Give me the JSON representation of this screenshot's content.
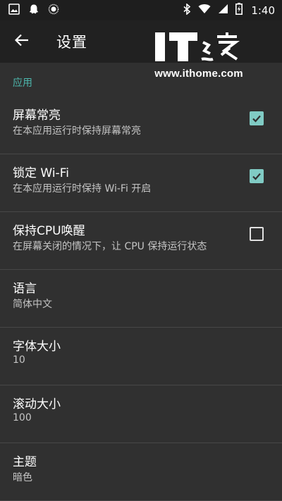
{
  "status_bar": {
    "time": "1:40",
    "icons": [
      "image-icon",
      "ghost-icon",
      "circle-icon",
      "bluetooth-icon",
      "wifi-icon",
      "signal-icon",
      "battery-charging-icon"
    ]
  },
  "app_bar": {
    "title": "设置",
    "back_icon": "arrow-left-icon"
  },
  "watermark": {
    "logo_text": "IT之家",
    "url": "www.ithome.com"
  },
  "settings": {
    "section_app": "应用",
    "items": [
      {
        "title": "屏幕常亮",
        "subtitle": "在本应用运行时保持屏幕常亮",
        "checked": true
      },
      {
        "title": "锁定 Wi-Fi",
        "subtitle": "在本应用运行时保持 Wi-Fi 开启",
        "checked": true
      },
      {
        "title": "保持CPU唤醒",
        "subtitle": "在屏幕关闭的情况下，让 CPU 保持运行状态",
        "checked": false
      },
      {
        "title": "语言",
        "subtitle": "简体中文"
      },
      {
        "title": "字体大小",
        "subtitle": "10"
      },
      {
        "title": "滚动大小",
        "subtitle": "100"
      },
      {
        "title": "主题",
        "subtitle": "暗色"
      }
    ]
  },
  "colors": {
    "accent": "#4db6ac",
    "checkbox_checked": "#80cbc4",
    "background": "#303030",
    "app_bar": "#212121"
  }
}
